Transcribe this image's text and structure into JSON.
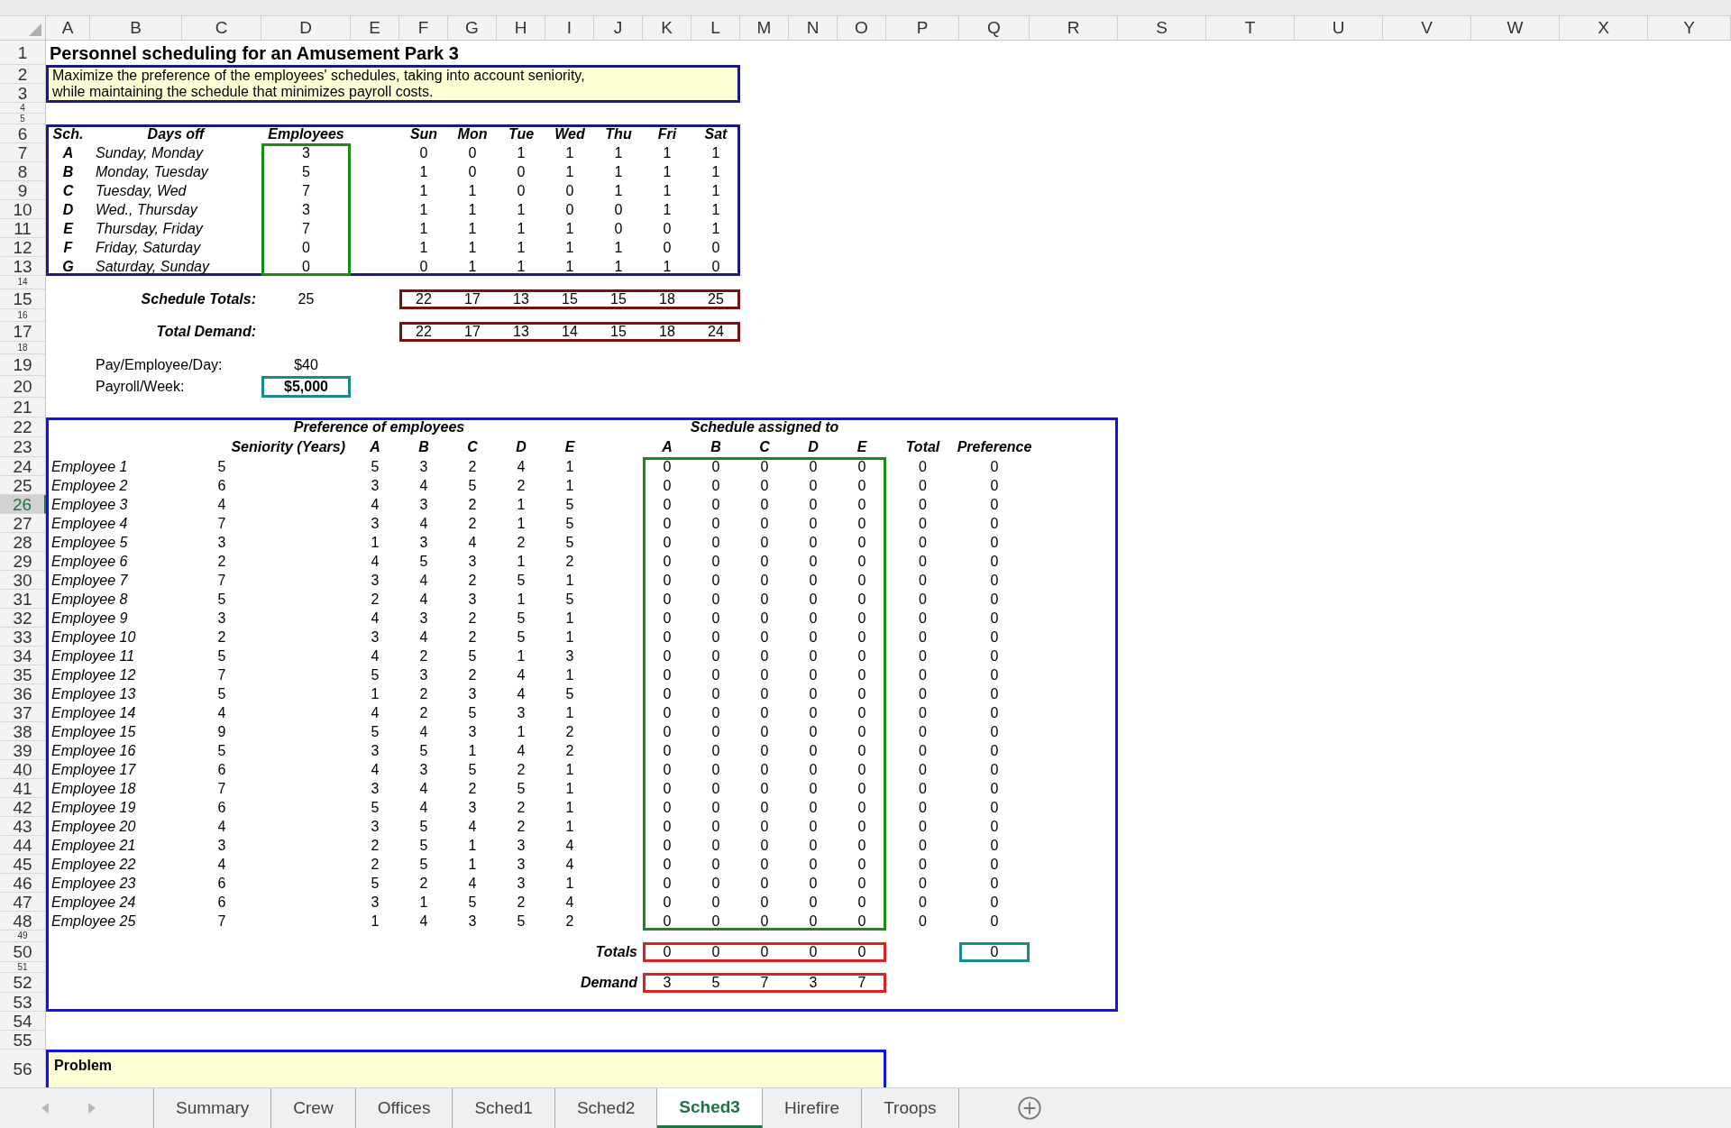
{
  "columns": [
    {
      "label": "A",
      "selected": false
    },
    {
      "label": "B",
      "selected": false
    },
    {
      "label": "C",
      "selected": false
    },
    {
      "label": "D",
      "selected": false
    },
    {
      "label": "E",
      "selected": false
    },
    {
      "label": "F",
      "selected": false
    },
    {
      "label": "G",
      "selected": false
    },
    {
      "label": "H",
      "selected": false
    },
    {
      "label": "I",
      "selected": false
    },
    {
      "label": "J",
      "selected": false
    },
    {
      "label": "K",
      "selected": false
    },
    {
      "label": "L",
      "selected": false
    },
    {
      "label": "M",
      "selected": false
    },
    {
      "label": "N",
      "selected": false
    },
    {
      "label": "O",
      "selected": false
    },
    {
      "label": "P",
      "selected": false
    },
    {
      "label": "Q",
      "selected": false
    },
    {
      "label": "R",
      "selected": false
    },
    {
      "label": "S",
      "selected": false
    },
    {
      "label": "T",
      "selected": false
    },
    {
      "label": "U",
      "selected": false
    },
    {
      "label": "V",
      "selected": false
    },
    {
      "label": "W",
      "selected": false
    },
    {
      "label": "X",
      "selected": false
    },
    {
      "label": "Y",
      "selected": false
    }
  ],
  "rows": [
    {
      "number": "1",
      "selected": false
    },
    {
      "number": "2",
      "selected": false
    },
    {
      "number": "3",
      "selected": false
    },
    {
      "number": "4",
      "selected": false
    },
    {
      "number": "5",
      "selected": false
    },
    {
      "number": "6",
      "selected": false
    },
    {
      "number": "7",
      "selected": false
    },
    {
      "number": "8",
      "selected": false
    },
    {
      "number": "9",
      "selected": false
    },
    {
      "number": "10",
      "selected": false
    },
    {
      "number": "11",
      "selected": false
    },
    {
      "number": "12",
      "selected": false
    },
    {
      "number": "13",
      "selected": false
    },
    {
      "number": "14",
      "selected": false
    },
    {
      "number": "15",
      "selected": false
    },
    {
      "number": "16",
      "selected": false
    },
    {
      "number": "17",
      "selected": false
    },
    {
      "number": "18",
      "selected": false
    },
    {
      "number": "19",
      "selected": false
    },
    {
      "number": "20",
      "selected": false
    },
    {
      "number": "21",
      "selected": false
    },
    {
      "number": "22",
      "selected": false
    },
    {
      "number": "23",
      "selected": false
    },
    {
      "number": "24",
      "selected": false
    },
    {
      "number": "25",
      "selected": false
    },
    {
      "number": "26",
      "selected": true
    },
    {
      "number": "27",
      "selected": false
    },
    {
      "number": "28",
      "selected": false
    },
    {
      "number": "29",
      "selected": false
    },
    {
      "number": "30",
      "selected": false
    },
    {
      "number": "31",
      "selected": false
    },
    {
      "number": "32",
      "selected": false
    },
    {
      "number": "33",
      "selected": false
    },
    {
      "number": "34",
      "selected": false
    },
    {
      "number": "35",
      "selected": false
    },
    {
      "number": "36",
      "selected": false
    },
    {
      "number": "37",
      "selected": false
    },
    {
      "number": "38",
      "selected": false
    },
    {
      "number": "39",
      "selected": false
    },
    {
      "number": "40",
      "selected": false
    },
    {
      "number": "41",
      "selected": false
    },
    {
      "number": "42",
      "selected": false
    },
    {
      "number": "43",
      "selected": false
    },
    {
      "number": "44",
      "selected": false
    },
    {
      "number": "45",
      "selected": false
    },
    {
      "number": "46",
      "selected": false
    },
    {
      "number": "47",
      "selected": false
    },
    {
      "number": "48",
      "selected": false
    },
    {
      "number": "49",
      "selected": false
    },
    {
      "number": "50",
      "selected": false
    },
    {
      "number": "51",
      "selected": false
    },
    {
      "number": "52",
      "selected": false
    },
    {
      "number": "53",
      "selected": false
    },
    {
      "number": "54",
      "selected": false
    },
    {
      "number": "55",
      "selected": false
    },
    {
      "number": "56",
      "selected": false
    }
  ],
  "title": "Personnel scheduling for an Amusement Park 3",
  "description": "Maximize the preference of the employees' schedules, taking into account seniority, while maintaining the schedule that minimizes payroll costs.",
  "schedule_table": {
    "headers": [
      "Sch.",
      "Days off",
      "Employees",
      "Sun",
      "Mon",
      "Tue",
      "Wed",
      "Thu",
      "Fri",
      "Sat"
    ],
    "rows": [
      {
        "sch": "A",
        "days_off": "Sunday, Monday",
        "employees": "3",
        "days": [
          "0",
          "0",
          "1",
          "1",
          "1",
          "1",
          "1"
        ]
      },
      {
        "sch": "B",
        "days_off": "Monday, Tuesday",
        "employees": "5",
        "days": [
          "1",
          "0",
          "0",
          "1",
          "1",
          "1",
          "1"
        ]
      },
      {
        "sch": "C",
        "days_off": "Tuesday, Wed",
        "employees": "7",
        "days": [
          "1",
          "1",
          "0",
          "0",
          "1",
          "1",
          "1"
        ]
      },
      {
        "sch": "D",
        "days_off": "Wed., Thursday",
        "employees": "3",
        "days": [
          "1",
          "1",
          "1",
          "0",
          "0",
          "1",
          "1"
        ]
      },
      {
        "sch": "E",
        "days_off": "Thursday, Friday",
        "employees": "7",
        "days": [
          "1",
          "1",
          "1",
          "1",
          "0",
          "0",
          "1"
        ]
      },
      {
        "sch": "F",
        "days_off": "Friday, Saturday",
        "employees": "0",
        "days": [
          "1",
          "1",
          "1",
          "1",
          "1",
          "0",
          "0"
        ]
      },
      {
        "sch": "G",
        "days_off": "Saturday, Sunday",
        "employees": "0",
        "days": [
          "0",
          "1",
          "1",
          "1",
          "1",
          "1",
          "0"
        ]
      }
    ]
  },
  "schedule_totals": {
    "label": "Schedule Totals:",
    "total": "25",
    "values": [
      "22",
      "17",
      "13",
      "15",
      "15",
      "18",
      "25"
    ]
  },
  "total_demand": {
    "label": "Total Demand:",
    "values": [
      "22",
      "17",
      "13",
      "14",
      "15",
      "18",
      "24"
    ]
  },
  "pay_per_employee_day": {
    "label": "Pay/Employee/Day:",
    "value": "$40"
  },
  "payroll_week": {
    "label": "Payroll/Week:",
    "value": "$5,000"
  },
  "preferences": {
    "heading": "Preference of employees",
    "assigned_heading": "Schedule assigned to",
    "columns": [
      "Seniority (Years)",
      "A",
      "B",
      "C",
      "D",
      "E",
      "A",
      "B",
      "C",
      "D",
      "E",
      "Total",
      "Preference"
    ],
    "employees": [
      {
        "name": "Employee 1",
        "seniority": "5",
        "prefs": [
          "5",
          "3",
          "2",
          "4",
          "1"
        ],
        "assigned": [
          "0",
          "0",
          "0",
          "0",
          "0"
        ],
        "total": "0",
        "preference": "0"
      },
      {
        "name": "Employee 2",
        "seniority": "6",
        "prefs": [
          "3",
          "4",
          "5",
          "2",
          "1"
        ],
        "assigned": [
          "0",
          "0",
          "0",
          "0",
          "0"
        ],
        "total": "0",
        "preference": "0"
      },
      {
        "name": "Employee 3",
        "seniority": "4",
        "prefs": [
          "4",
          "3",
          "2",
          "1",
          "5"
        ],
        "assigned": [
          "0",
          "0",
          "0",
          "0",
          "0"
        ],
        "total": "0",
        "preference": "0"
      },
      {
        "name": "Employee 4",
        "seniority": "7",
        "prefs": [
          "3",
          "4",
          "2",
          "1",
          "5"
        ],
        "assigned": [
          "0",
          "0",
          "0",
          "0",
          "0"
        ],
        "total": "0",
        "preference": "0"
      },
      {
        "name": "Employee 5",
        "seniority": "3",
        "prefs": [
          "1",
          "3",
          "4",
          "2",
          "5"
        ],
        "assigned": [
          "0",
          "0",
          "0",
          "0",
          "0"
        ],
        "total": "0",
        "preference": "0"
      },
      {
        "name": "Employee 6",
        "seniority": "2",
        "prefs": [
          "4",
          "5",
          "3",
          "1",
          "2"
        ],
        "assigned": [
          "0",
          "0",
          "0",
          "0",
          "0"
        ],
        "total": "0",
        "preference": "0"
      },
      {
        "name": "Employee 7",
        "seniority": "7",
        "prefs": [
          "3",
          "4",
          "2",
          "5",
          "1"
        ],
        "assigned": [
          "0",
          "0",
          "0",
          "0",
          "0"
        ],
        "total": "0",
        "preference": "0"
      },
      {
        "name": "Employee 8",
        "seniority": "5",
        "prefs": [
          "2",
          "4",
          "3",
          "1",
          "5"
        ],
        "assigned": [
          "0",
          "0",
          "0",
          "0",
          "0"
        ],
        "total": "0",
        "preference": "0"
      },
      {
        "name": "Employee 9",
        "seniority": "3",
        "prefs": [
          "4",
          "3",
          "2",
          "5",
          "1"
        ],
        "assigned": [
          "0",
          "0",
          "0",
          "0",
          "0"
        ],
        "total": "0",
        "preference": "0"
      },
      {
        "name": "Employee 10",
        "seniority": "2",
        "prefs": [
          "3",
          "4",
          "2",
          "5",
          "1"
        ],
        "assigned": [
          "0",
          "0",
          "0",
          "0",
          "0"
        ],
        "total": "0",
        "preference": "0"
      },
      {
        "name": "Employee 11",
        "seniority": "5",
        "prefs": [
          "4",
          "2",
          "5",
          "1",
          "3"
        ],
        "assigned": [
          "0",
          "0",
          "0",
          "0",
          "0"
        ],
        "total": "0",
        "preference": "0"
      },
      {
        "name": "Employee 12",
        "seniority": "7",
        "prefs": [
          "5",
          "3",
          "2",
          "4",
          "1"
        ],
        "assigned": [
          "0",
          "0",
          "0",
          "0",
          "0"
        ],
        "total": "0",
        "preference": "0"
      },
      {
        "name": "Employee 13",
        "seniority": "5",
        "prefs": [
          "1",
          "2",
          "3",
          "4",
          "5"
        ],
        "assigned": [
          "0",
          "0",
          "0",
          "0",
          "0"
        ],
        "total": "0",
        "preference": "0"
      },
      {
        "name": "Employee 14",
        "seniority": "4",
        "prefs": [
          "4",
          "2",
          "5",
          "3",
          "1"
        ],
        "assigned": [
          "0",
          "0",
          "0",
          "0",
          "0"
        ],
        "total": "0",
        "preference": "0"
      },
      {
        "name": "Employee 15",
        "seniority": "9",
        "prefs": [
          "5",
          "4",
          "3",
          "1",
          "2"
        ],
        "assigned": [
          "0",
          "0",
          "0",
          "0",
          "0"
        ],
        "total": "0",
        "preference": "0"
      },
      {
        "name": "Employee 16",
        "seniority": "5",
        "prefs": [
          "3",
          "5",
          "1",
          "4",
          "2"
        ],
        "assigned": [
          "0",
          "0",
          "0",
          "0",
          "0"
        ],
        "total": "0",
        "preference": "0"
      },
      {
        "name": "Employee 17",
        "seniority": "6",
        "prefs": [
          "4",
          "3",
          "5",
          "2",
          "1"
        ],
        "assigned": [
          "0",
          "0",
          "0",
          "0",
          "0"
        ],
        "total": "0",
        "preference": "0"
      },
      {
        "name": "Employee 18",
        "seniority": "7",
        "prefs": [
          "3",
          "4",
          "2",
          "5",
          "1"
        ],
        "assigned": [
          "0",
          "0",
          "0",
          "0",
          "0"
        ],
        "total": "0",
        "preference": "0"
      },
      {
        "name": "Employee 19",
        "seniority": "6",
        "prefs": [
          "5",
          "4",
          "3",
          "2",
          "1"
        ],
        "assigned": [
          "0",
          "0",
          "0",
          "0",
          "0"
        ],
        "total": "0",
        "preference": "0"
      },
      {
        "name": "Employee 20",
        "seniority": "4",
        "prefs": [
          "3",
          "5",
          "4",
          "2",
          "1"
        ],
        "assigned": [
          "0",
          "0",
          "0",
          "0",
          "0"
        ],
        "total": "0",
        "preference": "0"
      },
      {
        "name": "Employee 21",
        "seniority": "3",
        "prefs": [
          "2",
          "5",
          "1",
          "3",
          "4"
        ],
        "assigned": [
          "0",
          "0",
          "0",
          "0",
          "0"
        ],
        "total": "0",
        "preference": "0"
      },
      {
        "name": "Employee 22",
        "seniority": "4",
        "prefs": [
          "2",
          "5",
          "1",
          "3",
          "4"
        ],
        "assigned": [
          "0",
          "0",
          "0",
          "0",
          "0"
        ],
        "total": "0",
        "preference": "0"
      },
      {
        "name": "Employee 23",
        "seniority": "6",
        "prefs": [
          "5",
          "2",
          "4",
          "3",
          "1"
        ],
        "assigned": [
          "0",
          "0",
          "0",
          "0",
          "0"
        ],
        "total": "0",
        "preference": "0"
      },
      {
        "name": "Employee 24",
        "seniority": "6",
        "prefs": [
          "3",
          "1",
          "5",
          "2",
          "4"
        ],
        "assigned": [
          "0",
          "0",
          "0",
          "0",
          "0"
        ],
        "total": "0",
        "preference": "0"
      },
      {
        "name": "Employee 25",
        "seniority": "7",
        "prefs": [
          "1",
          "4",
          "3",
          "5",
          "2"
        ],
        "assigned": [
          "0",
          "0",
          "0",
          "0",
          "0"
        ],
        "total": "0",
        "preference": "0"
      }
    ],
    "totals": {
      "label": "Totals",
      "values": [
        "0",
        "0",
        "0",
        "0",
        "0"
      ],
      "preference": "0"
    },
    "demand": {
      "label": "Demand",
      "values": [
        "3",
        "5",
        "7",
        "3",
        "7"
      ]
    }
  },
  "problem_heading": "Problem",
  "tabs": [
    {
      "label": "Summary",
      "selected": false
    },
    {
      "label": "Crew",
      "selected": false
    },
    {
      "label": "Offices",
      "selected": false
    },
    {
      "label": "Sched1",
      "selected": false
    },
    {
      "label": "Sched2",
      "selected": false
    },
    {
      "label": "Sched3",
      "selected": true
    },
    {
      "label": "Hirefire",
      "selected": false
    },
    {
      "label": "Troops",
      "selected": false
    }
  ]
}
